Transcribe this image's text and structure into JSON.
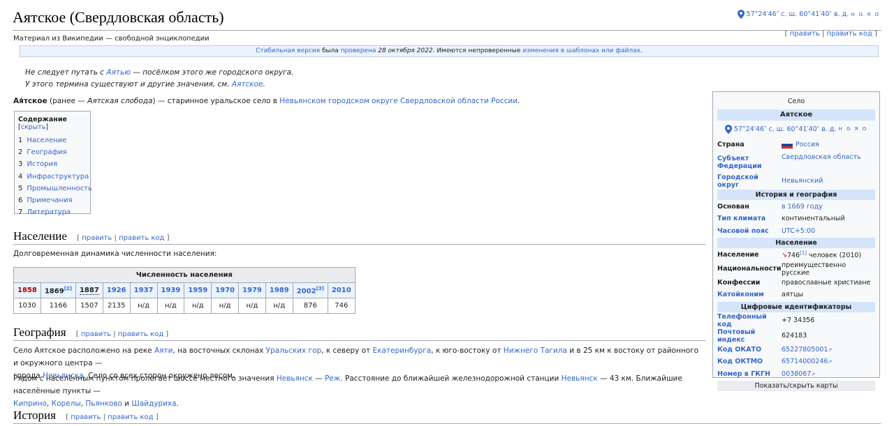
{
  "title": "Аятское (Свердловская область)",
  "tagline": "Материал из Википедии — свободной энциклопедии",
  "coords": {
    "text": "57°24′46″ с. ш. 60°41′40″ в. д.",
    "letters": "H G Я O"
  },
  "edit_links": {
    "edit": "править",
    "edit_code": "править код"
  },
  "flagged": {
    "stable": "Стабильная версия",
    "was": "была",
    "checked": "проверена",
    "date": "28 октября 2022",
    "rest": ". Имеются непроверенные",
    "changes": "изменения в шаблонах или файлах",
    "end": "."
  },
  "hatnotes": [
    {
      "pre": "Не следует путать с ",
      "link": "Аятью",
      "post": " — посёлком этого же городского округа."
    },
    {
      "pre": "У этого термина существуют и другие значения, см. ",
      "link": "Аятское",
      "post": "."
    }
  ],
  "lead": {
    "bold": "Ая́тское",
    "p1": " (ранее — ",
    "italic": "Аятская слобода",
    "p2": ") — старинное уральское село в ",
    "link1": "Невьянском городском округе Свердловской области",
    "link2": "России",
    "end": "."
  },
  "toc": {
    "title": "Содержание",
    "hide": "скрыть",
    "items": [
      {
        "num": "1",
        "label": "Население"
      },
      {
        "num": "2",
        "label": "География"
      },
      {
        "num": "3",
        "label": "История"
      },
      {
        "num": "4",
        "label": "Инфраструктура"
      },
      {
        "num": "5",
        "label": "Промышленность"
      },
      {
        "num": "6",
        "label": "Примечания"
      },
      {
        "num": "7",
        "label": "Литература"
      }
    ]
  },
  "sections": {
    "population": "Население",
    "geography": "География",
    "history": "История"
  },
  "population_intro": "Долговременная динамика численности населения:",
  "pop_table": {
    "caption": "Численность населения",
    "years": [
      "1858",
      "1869",
      "1887",
      "1926",
      "1937",
      "1939",
      "1959",
      "1970",
      "1979",
      "1989",
      "2002",
      "2010"
    ],
    "values": [
      "1030",
      "1166",
      "1507",
      "2135",
      "н/д",
      "н/д",
      "н/д",
      "н/д",
      "н/д",
      "н/д",
      "876",
      "746"
    ],
    "ref2": "[2]",
    "ref3": "[3]"
  },
  "geo": {
    "l1a": "Село Аятское расположено на реке ",
    "aiati": "Аяти",
    "l1b": ", на восточных склонах ",
    "ural": "Уральских гор",
    "l1c": ", к северу от ",
    "ekb": "Екатеринбурга",
    "l1d": ", к юго-востоку от ",
    "tagil": "Нижнего Тагила",
    "l1e": " и в 25 км к востоку от районного и окружного центра —",
    "l2a": "города ",
    "nev": "Невьянска",
    "l2b": ". Село со всех сторон окружено лесом.",
    "p2a": "Рядом с населённым пунктом пролегает шоссе местного значения ",
    "nev2": "Невьянск",
    "dash": " — ",
    "rezh": "Реж",
    "p2b": ". Расстояние до ближайшей железнодорожной станции ",
    "nev3": "Невьянск",
    "p2c": " — 43 км. Ближайшие населённые пункты —",
    "kip": "Киприно",
    "c1": ", ",
    "kor": "Корелы",
    "c2": ", ",
    "pyan": "Пьянково",
    "and": " и ",
    "shai": "Шайдуриха",
    "end": "."
  },
  "infobox": {
    "type": "Село",
    "name": "Аятское",
    "country_label": "Страна",
    "country": "Россия",
    "subject_label": "Субъект Федерации",
    "subject": "Свердловская область",
    "district_label": "Городской округ",
    "district": "Невьянский",
    "hist_head": "История и география",
    "founded_label": "Основан",
    "founded": "в 1669 году",
    "climate_label": "Тип климата",
    "climate": "континентальный",
    "tz_label": "Часовой пояс",
    "tz": "UTC+5:00",
    "pop_head": "Население",
    "pop_label": "Население",
    "pop_arrow": "↘",
    "pop_value": "746",
    "pop_ref": "[1]",
    "pop_unit": " человек (2010)",
    "nat_label": "Национальности",
    "nat": "преимущественно русские",
    "conf_label": "Конфессии",
    "conf": "православные христиане",
    "katoi_label": "Катойконим",
    "katoi": "аятцы",
    "ids_head": "Цифровые идентификаторы",
    "phone_label": "Телефонный код",
    "phone": "+7 34356",
    "postal_label": "Почтовый индекс",
    "postal": "624183",
    "okato_label": "Код ОКАТО",
    "okato": "65227805001",
    "oktmo_label": "Код ОКТМО",
    "oktmo": "65714000246",
    "gkgn_label": "Номер в ГКГН",
    "gkgn": "0038067",
    "maps_toggle": "Показать/скрыть карты"
  },
  "colors": {
    "link": "#3366cc",
    "redlink": "#ba0000",
    "infobox_head": "#d4e4fa",
    "border": "#a2a9b1"
  }
}
